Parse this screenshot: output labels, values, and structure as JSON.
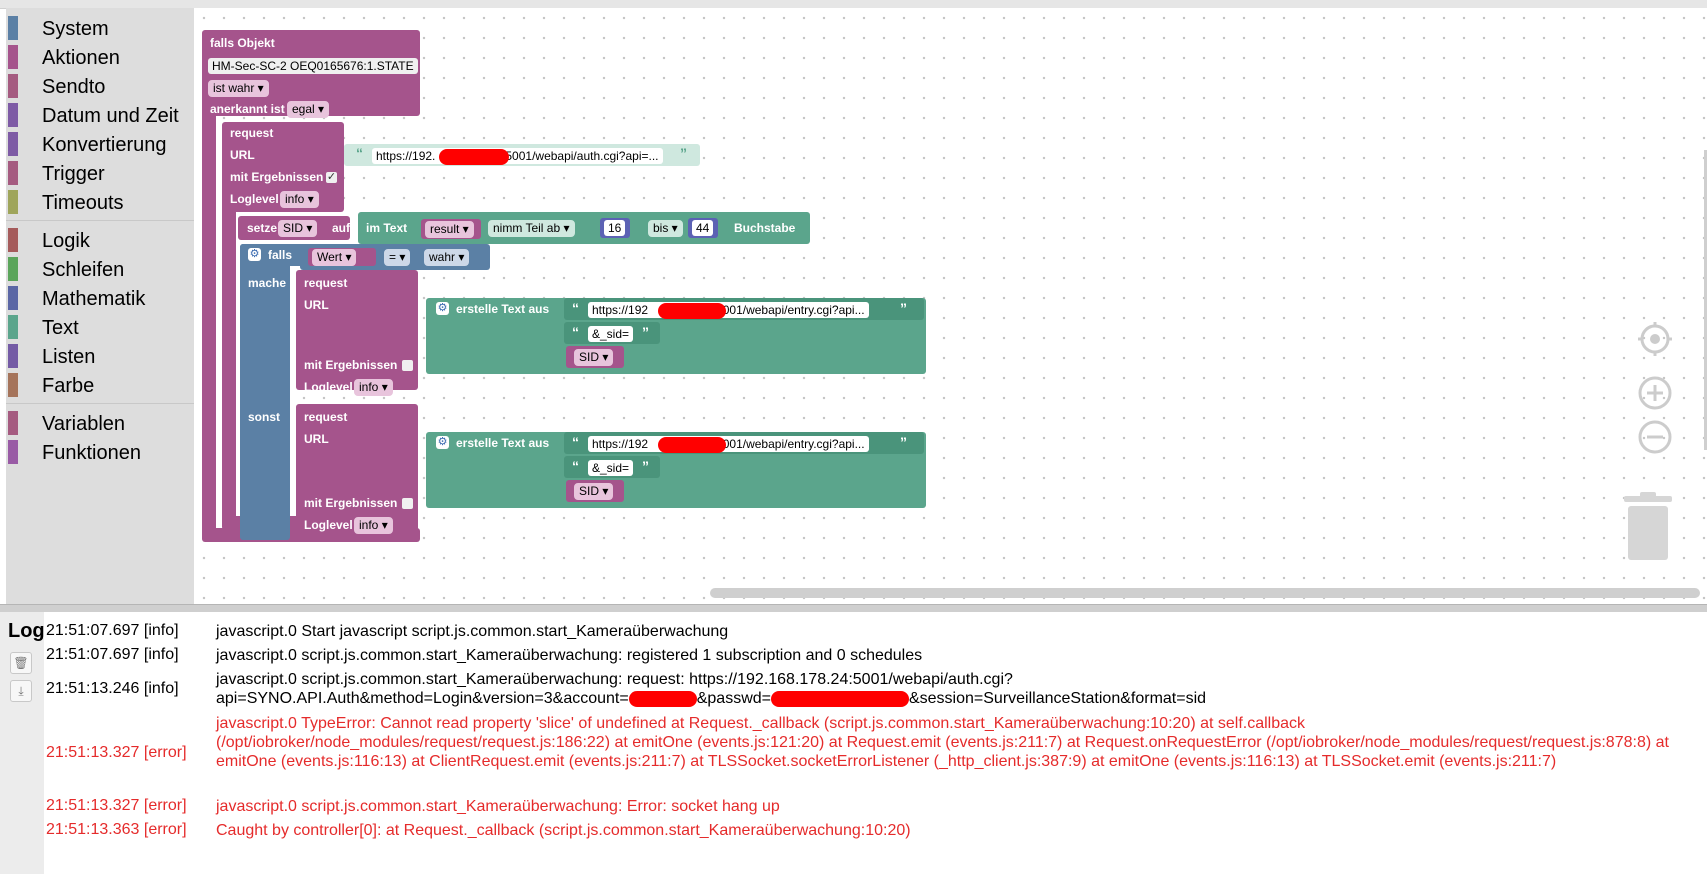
{
  "toolbox": {
    "categories": [
      {
        "label": "System",
        "color": "#5b80a5"
      },
      {
        "label": "Aktionen",
        "color": "#a5548c"
      },
      {
        "label": "Sendto",
        "color": "#a55b80"
      },
      {
        "label": "Datum und Zeit",
        "color": "#7e5ba5"
      },
      {
        "label": "Konvertierung",
        "color": "#7e5ba5"
      },
      {
        "label": "Trigger",
        "color": "#a55b80"
      },
      {
        "label": "Timeouts",
        "color": "#9fa55b"
      },
      {
        "label": "Logik",
        "color": "#a55b5b"
      },
      {
        "label": "Schleifen",
        "color": "#5ba55b"
      },
      {
        "label": "Mathematik",
        "color": "#5b67a5"
      },
      {
        "label": "Text",
        "color": "#5ba58c"
      },
      {
        "label": "Listen",
        "color": "#745ba5"
      },
      {
        "label": "Farbe",
        "color": "#a5745b"
      },
      {
        "label": "Variablen",
        "color": "#a55b80"
      },
      {
        "label": "Funktionen",
        "color": "#995ba5"
      }
    ]
  },
  "blocks": {
    "trigger_title": "falls Objekt",
    "object_id": "HM-Sec-SC-2 OEQ0165676:1.STATE",
    "condition": "ist wahr",
    "ack_label": "anerkannt ist",
    "ack_value": "egal",
    "request_label": "request",
    "url_label": "URL",
    "url1": "https://192.",
    "url1_tail": "5001/webapi/auth.cgi?api=...",
    "with_results": "mit Ergebnissen",
    "loglevel_label": "Loglevel",
    "loglevel_value": "info",
    "set_label": "setze",
    "set_var": "SID",
    "set_on": "auf",
    "in_text": "im Text",
    "result_var": "result",
    "take_part": "nimm Teil ab",
    "from_num": "16",
    "to_label": "bis",
    "to_num": "44",
    "chars": "Buchstabe",
    "if_label": "falls",
    "value_label": "Wert",
    "eq_op": "=",
    "true_label": "wahr",
    "do_label": "mache",
    "else_label": "sonst",
    "create_text": "erstelle Text aus",
    "url2": "https://192",
    "url2_tail": "5001/webapi/entry.cgi?api...",
    "sid_param": "&_sid=",
    "sid_var": "SID"
  },
  "log": {
    "title": "Log",
    "entries": [
      {
        "time": "21:51:07.697 [info]",
        "level": "info",
        "msg": "javascript.0 Start javascript script.js.common.start_Kameraüberwachung"
      },
      {
        "time": "21:51:07.697 [info]",
        "level": "info",
        "msg": "javascript.0 script.js.common.start_Kameraüberwachung: registered 1 subscription and 0 schedules"
      },
      {
        "time": "21:51:13.246 [info]",
        "level": "info",
        "msg_a": "javascript.0 script.js.common.start_Kameraüberwachung: request: https://192.168.178.24:5001/webapi/auth.cgi?",
        "msg_b": "api=SYNO.API.Auth&method=Login&version=3&account=",
        "msg_c": "&passwd=",
        "msg_d": "&session=SurveillanceStation&format=sid"
      },
      {
        "time": "21:51:13.327 [error]",
        "level": "error",
        "msg": "javascript.0 TypeError: Cannot read property 'slice' of undefined at Request._callback (script.js.common.start_Kameraüberwachung:10:20) at self.callback (/opt/iobroker/node_modules/request/request.js:186:22) at emitOne (events.js:121:20) at Request.emit (events.js:211:7) at Request.onRequestError (/opt/iobroker/node_modules/request/request.js:878:8) at emitOne (events.js:116:13) at ClientRequest.emit (events.js:211:7) at TLSSocket.socketErrorListener (_http_client.js:387:9) at emitOne (events.js:116:13) at TLSSocket.emit (events.js:211:7)"
      },
      {
        "time": "21:51:13.327 [error]",
        "level": "error",
        "msg": "javascript.0 script.js.common.start_Kameraüberwachung: Error: socket hang up"
      },
      {
        "time": "21:51:13.363 [error]",
        "level": "error",
        "msg": "Caught by controller[0]: at Request._callback (script.js.common.start_Kameraüberwachung:10:20)"
      }
    ]
  }
}
